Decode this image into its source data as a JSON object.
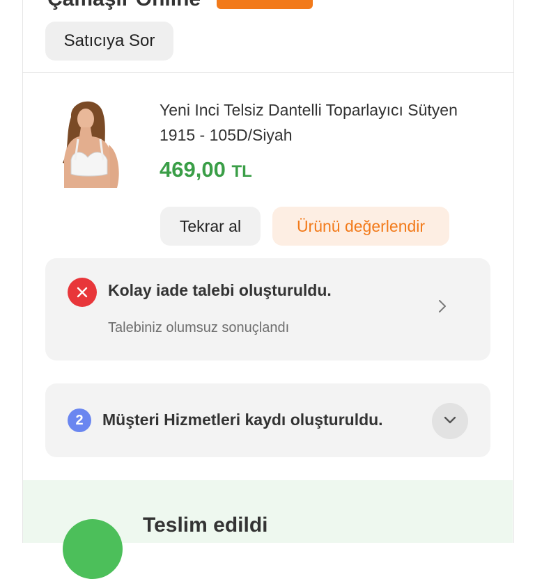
{
  "store": {
    "name": "Çamaşır Online",
    "ask_seller_label": "Satıcıya Sor"
  },
  "product": {
    "title": "Yeni Inci Telsiz Dantelli Toparlayıcı Sütyen 1915 - 105D/Siyah",
    "price_value": "469,00",
    "currency": "TL",
    "rebuy_label": "Tekrar al",
    "review_label": "Ürünü değerlendir"
  },
  "return_status": {
    "title": "Kolay iade talebi oluşturuldu.",
    "subtitle": "Talebiniz olumsuz sonuçlandı",
    "icon": "close-icon",
    "icon_color": "#e8363a"
  },
  "customer_service": {
    "badge": "2",
    "title": "Müşteri Hizmetleri kaydı oluşturuldu.",
    "icon": "chevron-down-icon"
  },
  "delivery": {
    "status": "Teslim edildi"
  },
  "colors": {
    "brand_orange": "#f27a1a",
    "price_green": "#3a9e47",
    "delivered_green": "#4cbf5a",
    "badge_blue": "#6a86f0"
  }
}
